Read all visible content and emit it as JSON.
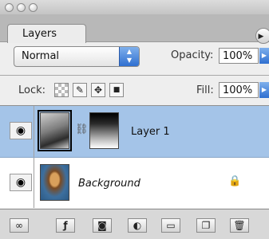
{
  "panel": {
    "tab_label": "Layers",
    "blend_mode": "Normal",
    "opacity_label": "Opacity:",
    "opacity_value": "100%",
    "lock_label": "Lock:",
    "fill_label": "Fill:",
    "fill_value": "100%"
  },
  "layers": [
    {
      "name": "Layer 1",
      "selected": true,
      "visible": true,
      "linked_mask": true,
      "locked": false
    },
    {
      "name": "Background",
      "selected": false,
      "visible": true,
      "linked_mask": false,
      "locked": true
    }
  ],
  "icons": {
    "window_buttons": [
      "close-icon",
      "minimize-icon",
      "zoom-icon"
    ],
    "lock": [
      "lock-transparent-icon",
      "lock-image-icon",
      "lock-position-icon",
      "lock-all-icon"
    ],
    "bottom": [
      "link-layers-icon",
      "layer-style-icon",
      "add-mask-icon",
      "adjustment-layer-icon",
      "new-group-icon",
      "new-layer-icon",
      "delete-layer-icon"
    ]
  },
  "colors": {
    "selected_row": "#a4c4e8",
    "accent_blue": "#2f6fd0",
    "panel_bg": "#eeeeee"
  }
}
